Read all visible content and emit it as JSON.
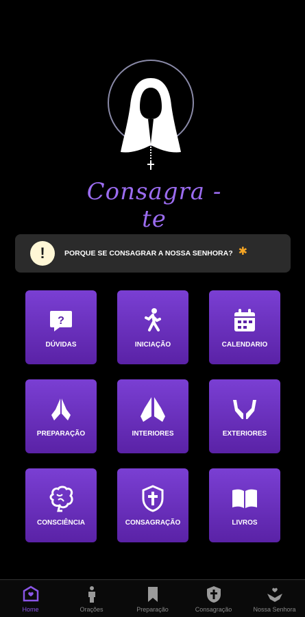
{
  "brand": {
    "logo_text": "Consagra - te"
  },
  "banner": {
    "text": "PORQUE SE CONSAGRAR A NOSSA SENHORA?",
    "icon": "alert-icon",
    "star": "✱"
  },
  "tiles": [
    {
      "label": "DÚVIDAS",
      "icon": "question-icon"
    },
    {
      "label": "INICIAÇÃO",
      "icon": "walking-icon"
    },
    {
      "label": "CALENDARIO",
      "icon": "calendar-icon"
    },
    {
      "label": "PREPARAÇÃO",
      "icon": "praying-hands-icon"
    },
    {
      "label": "INTERIORES",
      "icon": "praying-hands-icon"
    },
    {
      "label": "EXTERIORES",
      "icon": "open-hands-icon"
    },
    {
      "label": "CONSCIÊNCIA",
      "icon": "brain-icon"
    },
    {
      "label": "CONSAGRAÇÃO",
      "icon": "cross-shield-icon"
    },
    {
      "label": "LIVROS",
      "icon": "book-icon"
    }
  ],
  "nav": [
    {
      "label": "Home",
      "icon": "home-icon",
      "active": true
    },
    {
      "label": "Orações",
      "icon": "person-icon"
    },
    {
      "label": "Preparação",
      "icon": "bookmark-icon"
    },
    {
      "label": "Consagração",
      "icon": "cross-shield-icon"
    },
    {
      "label": "Nossa Senhora",
      "icon": "hands-heart-icon"
    }
  ],
  "colors": {
    "accent": "#8a55e6",
    "tile_top": "#7a3fd3",
    "tile_bottom": "#5a22a6",
    "banner_bg": "#2b2b2b",
    "star": "#f5a524"
  }
}
